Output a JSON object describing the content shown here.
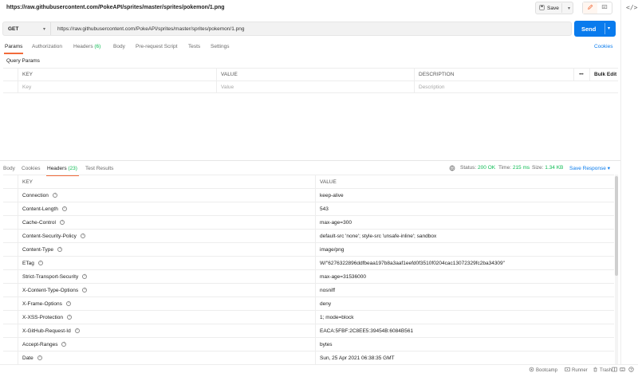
{
  "window": {
    "title": "https://raw.githubusercontent.com/PokeAPI/sprites/master/sprites/pokemon/1.png"
  },
  "toolbar": {
    "save_label": "Save",
    "code_label": "</>"
  },
  "request": {
    "method": "GET",
    "url": "https://raw.githubusercontent.com/PokeAPI/sprites/master/sprites/pokemon/1.png",
    "send_label": "Send"
  },
  "request_tabs": {
    "params": "Params",
    "authorization": "Authorization",
    "headers": "Headers",
    "headers_count": "(6)",
    "body": "Body",
    "prerequest": "Pre-request Script",
    "tests": "Tests",
    "settings": "Settings",
    "cookies": "Cookies"
  },
  "query_params": {
    "section_label": "Query Params",
    "col_key": "KEY",
    "col_value": "VALUE",
    "col_desc": "DESCRIPTION",
    "more": "•••",
    "bulk_edit": "Bulk Edit",
    "placeholder_key": "Key",
    "placeholder_value": "Value",
    "placeholder_desc": "Description"
  },
  "response_tabs": {
    "body": "Body",
    "cookies": "Cookies",
    "headers": "Headers",
    "headers_count": "(23)",
    "test_results": "Test Results"
  },
  "status": {
    "status_label": "Status:",
    "status_value": "200 OK",
    "time_label": "Time:",
    "time_value": "215 ms",
    "size_label": "Size:",
    "size_value": "1.34 KB",
    "save_response": "Save Response"
  },
  "response_headers": {
    "col_key": "KEY",
    "col_value": "VALUE",
    "rows": [
      {
        "key": "Connection",
        "value": "keep-alive"
      },
      {
        "key": "Content-Length",
        "value": "543"
      },
      {
        "key": "Cache-Control",
        "value": "max-age=300"
      },
      {
        "key": "Content-Security-Policy",
        "value": "default-src 'none'; style-src 'unsafe-inline'; sandbox"
      },
      {
        "key": "Content-Type",
        "value": "image/png"
      },
      {
        "key": "ETag",
        "value": "W/\"6276322896ddfbeaa197b8a3aaf1eefd0f3510f0204cac13072329fc2ba34309\""
      },
      {
        "key": "Strict-Transport-Security",
        "value": "max-age=31536000"
      },
      {
        "key": "X-Content-Type-Options",
        "value": "nosniff"
      },
      {
        "key": "X-Frame-Options",
        "value": "deny"
      },
      {
        "key": "X-XSS-Protection",
        "value": "1; mode=block"
      },
      {
        "key": "X-GitHub-Request-Id",
        "value": "EACA:5FBF:2C8EE5:39454B:6084B561"
      },
      {
        "key": "Accept-Ranges",
        "value": "bytes"
      },
      {
        "key": "Date",
        "value": "Sun, 25 Apr 2021 06:38:35 GMT"
      }
    ]
  },
  "footer": {
    "bootcamp": "Bootcamp",
    "runner": "Runner",
    "trash": "Trash"
  },
  "colors": {
    "accent": "#f26b3a",
    "primary": "#097bed",
    "success": "#0cbb52"
  },
  "icons": [
    "save-icon",
    "pencil-icon",
    "comment-icon",
    "code-icon",
    "globe-icon",
    "bootcamp-icon",
    "runner-icon",
    "trash-icon",
    "layout-icon",
    "keyboard-icon",
    "help-icon",
    "info-icon"
  ]
}
